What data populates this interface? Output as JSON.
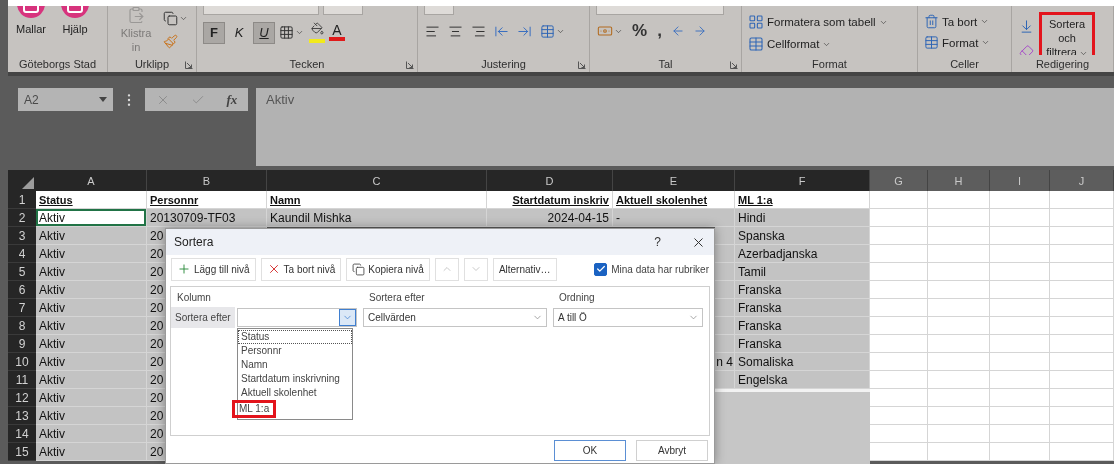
{
  "ribbon": {
    "groups": [
      {
        "kind": "brand",
        "label": "Göteborgs Stad",
        "launcher": false,
        "commands": [
          {
            "label": "Mallar"
          },
          {
            "label": "Hjälp"
          }
        ]
      },
      {
        "kind": "clipboard",
        "label": "Urklipp",
        "launcher": true,
        "paste": {
          "label": "Klistra in",
          "disabled": true
        }
      },
      {
        "kind": "font",
        "label": "Tecken",
        "launcher": true,
        "toggles": [
          {
            "label": "F",
            "on": true
          },
          {
            "label": "K",
            "on": false
          },
          {
            "label": "U",
            "on": true
          }
        ],
        "font_color_label": "A"
      },
      {
        "kind": "alignment",
        "label": "Justering",
        "launcher": true
      },
      {
        "kind": "number",
        "label": "Tal",
        "launcher": true,
        "percent_label": "%",
        "comma_label": ","
      },
      {
        "kind": "styles",
        "label": "Format",
        "launcher": false,
        "commands": [
          {
            "label": "Formatera som tabell"
          },
          {
            "label": "Cellformat"
          }
        ]
      },
      {
        "kind": "cells",
        "label": "Celler",
        "launcher": false,
        "commands": [
          {
            "label": "Ta bort"
          },
          {
            "label": "Format"
          }
        ]
      },
      {
        "kind": "editing",
        "label": "Redigering",
        "launcher": false,
        "sort_filter": {
          "label": "Sortera och filtrera",
          "highlighted": true
        }
      }
    ]
  },
  "formula_bar": {
    "name_box": "A2",
    "function_label": "fx",
    "value": "Aktiv"
  },
  "sheet": {
    "columns": [
      {
        "label": "A",
        "selected": true
      },
      {
        "label": "B",
        "selected": true
      },
      {
        "label": "C",
        "selected": true
      },
      {
        "label": "D",
        "selected": true
      },
      {
        "label": "E",
        "selected": true
      },
      {
        "label": "F",
        "selected": true
      },
      {
        "label": "G",
        "selected": false
      },
      {
        "label": "H",
        "selected": false
      },
      {
        "label": "I",
        "selected": false
      },
      {
        "label": "J",
        "selected": false
      }
    ],
    "rows": [
      {
        "number": "1",
        "kind": "header",
        "active": false,
        "status": "Status",
        "personnr": "Personnr",
        "namn": "Namn",
        "startdatum": "Startdatum inskriv",
        "skolenhet": "Aktuell skolenhet",
        "ml": "ML 1:a"
      },
      {
        "number": "2",
        "kind": "data",
        "active": true,
        "status": "Aktiv",
        "personnr": "20130709-TF03",
        "namn": "Kaundil Mishka",
        "startdatum": "2024-04-15",
        "skolenhet": "-",
        "ml": "Hindi"
      },
      {
        "number": "3",
        "kind": "data",
        "active": false,
        "status": "Aktiv",
        "personnr": "20",
        "ml": "Spanska"
      },
      {
        "number": "4",
        "kind": "data",
        "active": false,
        "status": "Aktiv",
        "personnr": "20",
        "ml": "Azerbadjanska"
      },
      {
        "number": "5",
        "kind": "data",
        "active": false,
        "status": "Aktiv",
        "personnr": "20",
        "ml": "Tamil"
      },
      {
        "number": "6",
        "kind": "data",
        "active": false,
        "status": "Aktiv",
        "personnr": "20",
        "ml": "Franska"
      },
      {
        "number": "7",
        "kind": "data",
        "active": false,
        "status": "Aktiv",
        "personnr": "20",
        "ml": "Franska"
      },
      {
        "number": "8",
        "kind": "data",
        "active": false,
        "status": "Aktiv",
        "personnr": "20",
        "ml": "Franska"
      },
      {
        "number": "9",
        "kind": "data",
        "active": false,
        "status": "Aktiv",
        "personnr": "20",
        "ml": "Franska"
      },
      {
        "number": "10",
        "kind": "data",
        "active": false,
        "status": "Aktiv",
        "personnr": "20",
        "skolenhet": "n 4",
        "ml": "Somaliska"
      },
      {
        "number": "11",
        "kind": "data",
        "active": false,
        "status": "Aktiv",
        "personnr": "20",
        "ml": "Engelska"
      },
      {
        "number": "12",
        "kind": "data",
        "active": false,
        "status": "Aktiv",
        "personnr": "20"
      },
      {
        "number": "13",
        "kind": "data",
        "active": false,
        "status": "Aktiv",
        "personnr": "20"
      },
      {
        "number": "14",
        "kind": "data",
        "active": false,
        "status": "Aktiv",
        "personnr": "20"
      },
      {
        "number": "15",
        "kind": "data",
        "active": false,
        "status": "Aktiv",
        "personnr": "20"
      }
    ]
  },
  "dialog": {
    "title": "Sortera",
    "help": "?",
    "toolbar": [
      {
        "kind": "add",
        "label": "Lägg till nivå",
        "disabled": false
      },
      {
        "kind": "delete",
        "label": "Ta bort nivå",
        "disabled": false
      },
      {
        "kind": "copy",
        "label": "Kopiera nivå",
        "disabled": false
      },
      {
        "kind": "up",
        "disabled": true
      },
      {
        "kind": "down",
        "disabled": true
      },
      {
        "kind": "options",
        "label": "Alternativ…",
        "disabled": false
      }
    ],
    "has_headers": {
      "label": "Mina data har rubriker",
      "checked": true
    },
    "columns": [
      "Kolumn",
      "Sortera efter",
      "Ordning"
    ],
    "level": {
      "label": "Sortera efter",
      "sort_on": "Cellvärden",
      "order": "A till Ö"
    },
    "column_options": [
      {
        "label": "Status",
        "selected": true,
        "highlighted": false
      },
      {
        "label": "Personnr",
        "selected": false,
        "highlighted": false
      },
      {
        "label": "Namn",
        "selected": false,
        "highlighted": false
      },
      {
        "label": "Startdatum inskrivning",
        "selected": false,
        "highlighted": false
      },
      {
        "label": "Aktuell skolenhet",
        "selected": false,
        "highlighted": false
      },
      {
        "label": "ML 1:a",
        "selected": false,
        "highlighted": true
      }
    ],
    "buttons": [
      {
        "label": "OK",
        "default": true
      },
      {
        "label": "Avbryt",
        "default": false
      }
    ]
  }
}
